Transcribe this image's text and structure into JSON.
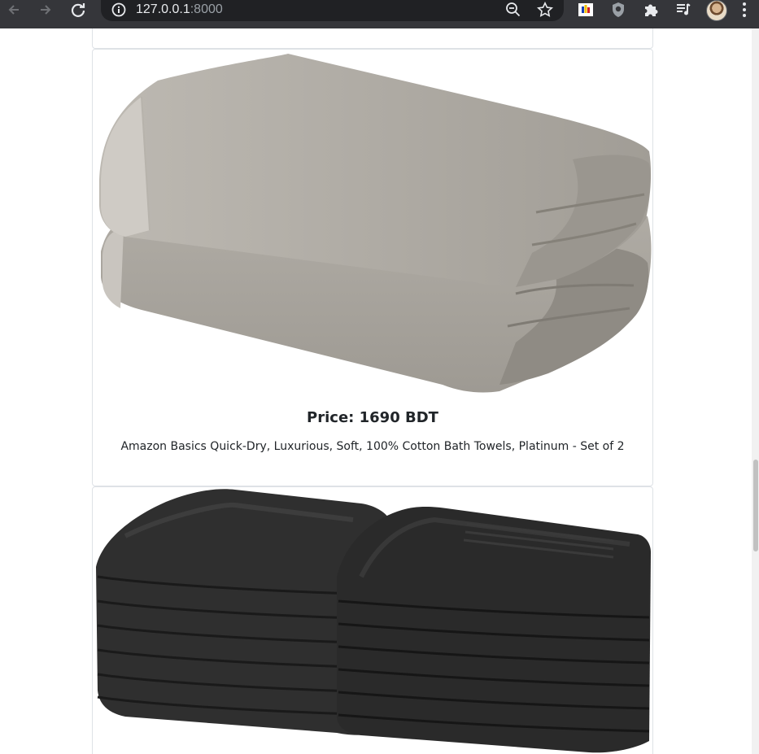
{
  "browser": {
    "url_host": "127.0.0.1",
    "url_port": ":8000",
    "icons": [
      "back-icon",
      "forward-icon",
      "reload-icon",
      "info-icon",
      "zoom-icon",
      "star-icon",
      "extension-flag-icon",
      "extension-shield-icon",
      "puzzle-icon",
      "media-playlist-icon",
      "profile-avatar",
      "menu-dots-icon"
    ],
    "colors": {
      "toolbar": "#35363a",
      "omnibox": "#202124"
    }
  },
  "products": [
    {
      "price": "Price: 1690 BDT",
      "title": "Amazon Basics Quick-Dry, Luxurious, Soft, 100% Cotton Bath Towels, Platinum - Set of 2",
      "image": "gray-folded-towels"
    },
    {
      "image": "black-stacked-washcloths"
    }
  ]
}
